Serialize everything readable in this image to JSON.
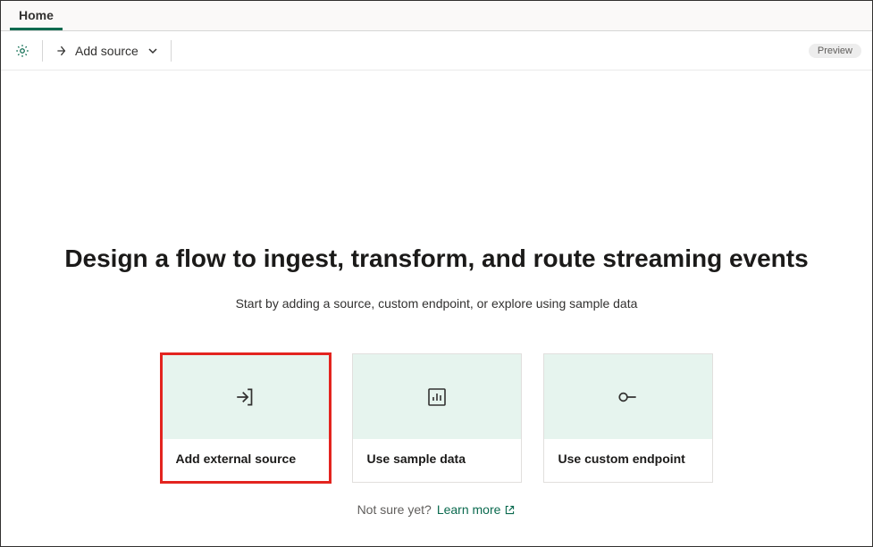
{
  "tabs": {
    "home": "Home"
  },
  "toolbar": {
    "addSource": "Add source",
    "previewBadge": "Preview"
  },
  "main": {
    "heading": "Design a flow to ingest, transform, and route streaming events",
    "subheading": "Start by adding a source, custom endpoint, or explore using sample data",
    "cards": {
      "external": "Add external source",
      "sample": "Use sample data",
      "custom": "Use custom endpoint"
    },
    "footer": {
      "prompt": "Not sure yet?",
      "link": "Learn more"
    }
  }
}
